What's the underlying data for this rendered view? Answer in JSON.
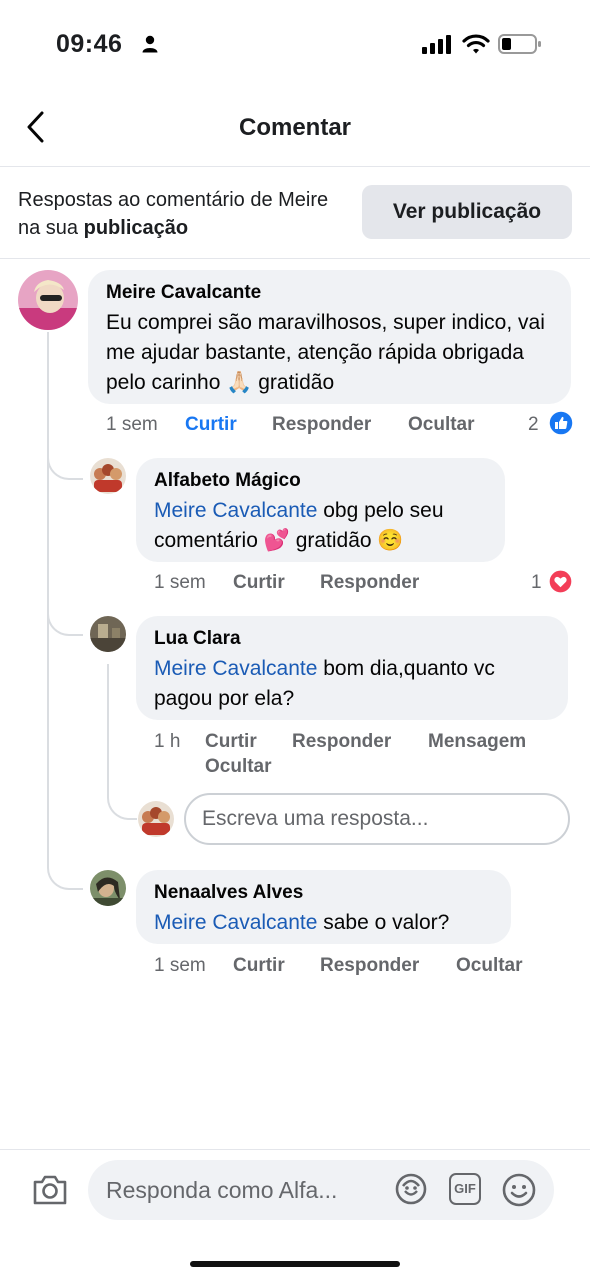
{
  "status_bar": {
    "time": "09:46"
  },
  "header": {
    "title": "Comentar"
  },
  "context": {
    "text": "Respostas ao comentário de Meire na sua ",
    "bold": "publicação",
    "button": "Ver publicação"
  },
  "comments": [
    {
      "name": "Meire Cavalcante",
      "text": "Eu comprei são maravilhosos, super indico, vai me ajudar bastante, atenção rápida obrigada pelo carinho 🙏🏻 gratidão",
      "time": "1 sem",
      "like": "Curtir",
      "reply": "Responder",
      "hide": "Ocultar",
      "reaction_count": "2"
    },
    {
      "name": "Alfabeto Mágico",
      "mention": "Meire Cavalcante",
      "text": " obg pelo seu comentário 💕 gratidão ☺️",
      "time": "1 sem",
      "like": "Curtir",
      "reply": "Responder",
      "reaction_count": "1"
    },
    {
      "name": "Lua Clara",
      "mention": "Meire Cavalcante",
      "text": " bom dia,quanto vc pagou por ela?",
      "time": "1 h",
      "like": "Curtir",
      "reply": "Responder",
      "message": "Mensagem",
      "hide": "Ocultar"
    },
    {
      "name": "Nenaalves Alves",
      "mention": "Meire Cavalcante",
      "text": " sabe o valor?",
      "time": "1 sem",
      "like": "Curtir",
      "reply": "Responder",
      "hide": "Ocultar"
    }
  ],
  "reply_box": {
    "placeholder": "Escreva uma resposta..."
  },
  "bottom_bar": {
    "placeholder": "Responda como Alfa...",
    "gif_label": "GIF"
  },
  "colors": {
    "facebook_blue": "#1877f2",
    "mention_blue": "#1a5bb5",
    "bubble_bg": "#f0f2f5",
    "heart_red": "#f33e58"
  },
  "icons": [
    "person-icon",
    "signal-icon",
    "wifi-icon",
    "battery-icon",
    "back-arrow-icon",
    "like-reaction-icon",
    "love-reaction-icon",
    "camera-icon",
    "avatar-sticker-icon",
    "gif-icon",
    "emoji-icon"
  ]
}
